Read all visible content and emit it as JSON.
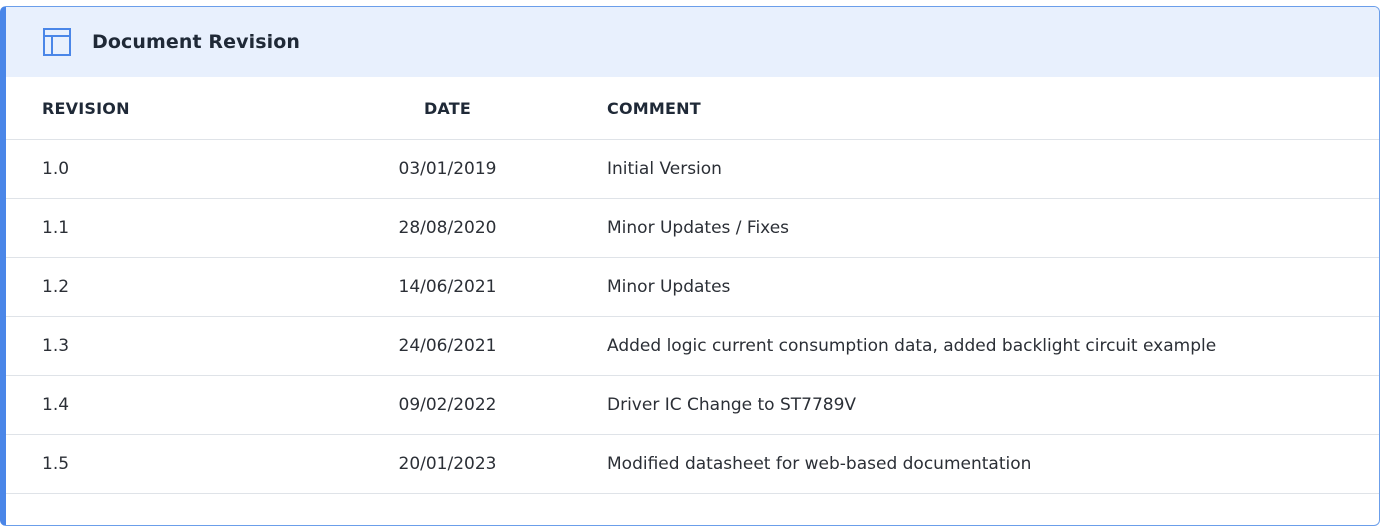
{
  "panel": {
    "title": "Document Revision",
    "icon": "table-icon",
    "accent_color": "#4a86e8",
    "header_bg": "#e8f0fd"
  },
  "table": {
    "headers": {
      "revision": "REVISION",
      "date": "DATE",
      "comment": "COMMENT"
    },
    "rows": [
      {
        "revision": "1.0",
        "date": "03/01/2019",
        "comment": "Initial Version"
      },
      {
        "revision": "1.1",
        "date": "28/08/2020",
        "comment": "Minor Updates / Fixes"
      },
      {
        "revision": "1.2",
        "date": "14/06/2021",
        "comment": "Minor Updates"
      },
      {
        "revision": "1.3",
        "date": "24/06/2021",
        "comment": "Added logic current consumption data, added backlight circuit example"
      },
      {
        "revision": "1.4",
        "date": "09/02/2022",
        "comment": "Driver IC Change to ST7789V"
      },
      {
        "revision": "1.5",
        "date": "20/01/2023",
        "comment": "Modified datasheet for web-based documentation"
      }
    ]
  }
}
